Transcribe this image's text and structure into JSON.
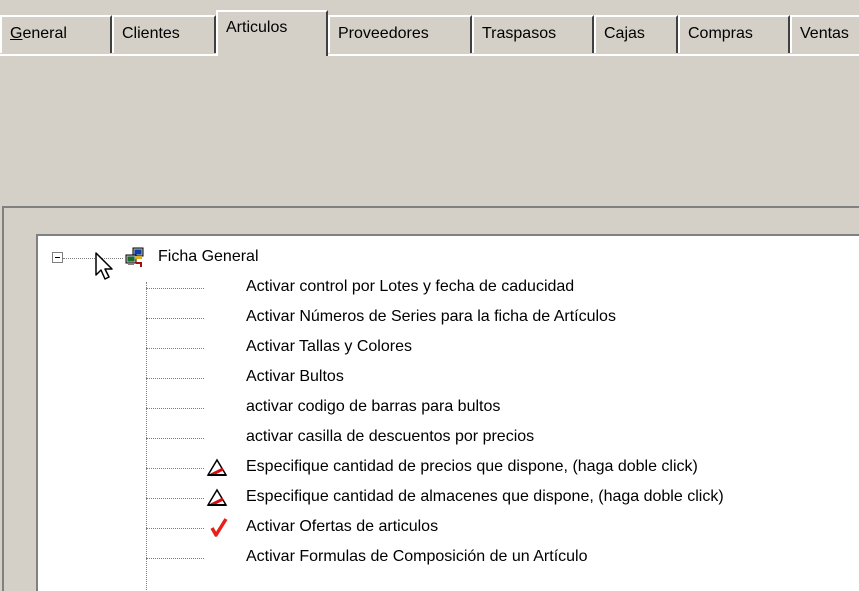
{
  "tabs": [
    {
      "label_mnemonic": "G",
      "label_rest": "eneral",
      "active": false
    },
    {
      "label": "Clientes",
      "active": false
    },
    {
      "label": "Articulos",
      "active": true
    },
    {
      "label": "Proveedores",
      "active": false
    },
    {
      "label": "Traspasos",
      "active": false
    },
    {
      "label": "Cajas",
      "active": false
    },
    {
      "label": "Compras",
      "active": false
    },
    {
      "label": "Ventas",
      "active": false
    }
  ],
  "tree": {
    "root": {
      "label": "Ficha General",
      "icon": "computer-network-icon",
      "expanded": true
    },
    "items": [
      {
        "label": "Activar control por Lotes y fecha de caducidad",
        "icon": ""
      },
      {
        "label": "Activar Números de Series para la ficha de Artículos",
        "icon": ""
      },
      {
        "label": "Activar Tallas y Colores",
        "icon": ""
      },
      {
        "label": "Activar Bultos",
        "icon": ""
      },
      {
        "label": "activar codigo de barras para bultos",
        "icon": ""
      },
      {
        "label": "activar casilla de descuentos por precios",
        "icon": ""
      },
      {
        "label": "Especifique cantidad de precios que dispone, (haga doble click)",
        "icon": "warning-triangle-icon"
      },
      {
        "label": "Especifique cantidad de almacenes que dispone, (haga doble click)",
        "icon": "warning-triangle-icon"
      },
      {
        "label": "Activar Ofertas de articulos",
        "icon": "checkmark-icon"
      },
      {
        "label": "Activar Formulas de Composición de un Artículo",
        "icon": ""
      }
    ]
  },
  "colors": {
    "face": "#d4d0c8",
    "tree_bg": "#ffffff",
    "check_red": "#e8201a"
  }
}
